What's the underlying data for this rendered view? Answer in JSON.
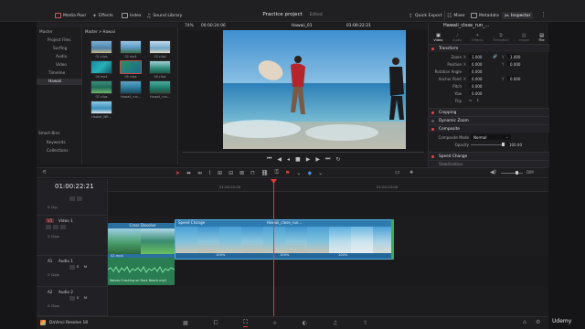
{
  "topbar": {
    "media_pool": "Media Pool",
    "effects": "Effects",
    "index": "Index",
    "sound_library": "Sound Library",
    "project_title": "Practice project",
    "project_status": "Edited",
    "quick_export": "Quick Export",
    "mixer": "Mixer",
    "metadata": "Metadata",
    "inspector": "Inspector"
  },
  "viewer": {
    "zoom": "74%",
    "source_tc": "00:00:24:06",
    "clip_name": "Hawaii_01",
    "timeline_tc": "01:00:22:21"
  },
  "media": {
    "bins": [
      "Master",
      "Project Files",
      "Surfing",
      "Audio",
      "Video",
      "Timeline",
      "Hawaii"
    ],
    "selected_bin": "Hawaii",
    "breadcrumb": "Master > Hawaii",
    "smart_bins": "Smart Bins",
    "smart_items": [
      "Keywords",
      "Collections"
    ],
    "clips": [
      "01.clips",
      "02.mp4",
      "03.clips",
      "04.mp4",
      "05.clips",
      "06.clips",
      "07.clips",
      "Hawaii_run...",
      "Hawaii_run...",
      "Hawaii_Wit..."
    ]
  },
  "inspector": {
    "clip_title": "Hawaii_close_run_...",
    "tabs": [
      "Video",
      "Audio",
      "Effects",
      "Transition",
      "Image",
      "File"
    ],
    "sections": {
      "transform": "Transform",
      "cropping": "Cropping",
      "dynamic_zoom": "Dynamic Zoom",
      "composite": "Composite",
      "speed_change": "Speed Change",
      "stabilization": "Stabilization"
    },
    "rows": [
      {
        "label": "Zoom",
        "x": "1.000",
        "y": "1.000"
      },
      {
        "label": "Position",
        "x": "0.000",
        "y": "0.000"
      },
      {
        "label": "Rotation Angle",
        "x": "0.000",
        "y": ""
      },
      {
        "label": "Anchor Point",
        "x": "0.000",
        "y": "0.000"
      },
      {
        "label": "Pitch",
        "x": "0.000",
        "y": ""
      },
      {
        "label": "Yaw",
        "x": "0.000",
        "y": ""
      },
      {
        "label": "Flip",
        "x": "",
        "y": ""
      }
    ],
    "composite_mode_label": "Composite Mode",
    "composite_mode_value": "Normal",
    "opacity_label": "Opacity",
    "opacity_value": "100.00"
  },
  "timeline": {
    "timecode": "01:00:22:21",
    "ruler_marks": [
      "01:00:22:00",
      "01:00:23:00"
    ],
    "tracks": [
      {
        "id": "V2",
        "name": "",
        "clips": "0 Clip"
      },
      {
        "id": "V1",
        "name": "Video 1",
        "clips": "2 Clips"
      },
      {
        "id": "A1",
        "name": "Audio 1",
        "clips": "2 Clips"
      },
      {
        "id": "A2",
        "name": "Audio 2",
        "clips": "0 Clips"
      }
    ],
    "video_clips": [
      {
        "title": "Cross Dissolve",
        "footer": "02.mp4"
      },
      {
        "title": "Speed Change",
        "footer": "100%",
        "center_title": "Hawaii_close_run..."
      }
    ],
    "audio_clip": "Waves Crashing on Rock Beach.mp3",
    "speed_values": [
      "100%",
      "100%",
      "100%",
      "100%",
      "100%"
    ]
  },
  "bottom": {
    "app_name": "DaVinci Resolve 18",
    "watermark": "Udemy"
  }
}
